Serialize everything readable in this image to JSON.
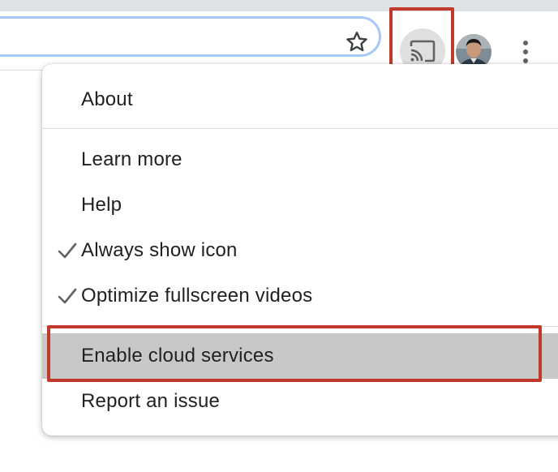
{
  "colors": {
    "accent_highlight": "#c0392b",
    "omnibox_border": "#a8c7fa",
    "menu_hover": "#c8c8c8"
  },
  "toolbar": {
    "star_icon": "star-outline-icon",
    "cast_icon": "cast-icon",
    "avatar_icon": "profile-avatar",
    "menu_icon": "three-dot-menu-icon"
  },
  "menu": {
    "items": [
      {
        "label": "About",
        "checked": false
      },
      {
        "label": "Learn more",
        "checked": false
      },
      {
        "label": "Help",
        "checked": false
      },
      {
        "label": "Always show icon",
        "checked": true
      },
      {
        "label": "Optimize fullscreen videos",
        "checked": true
      },
      {
        "label": "Enable cloud services",
        "checked": false,
        "highlighted": true
      },
      {
        "label": "Report an issue",
        "checked": false
      }
    ]
  }
}
